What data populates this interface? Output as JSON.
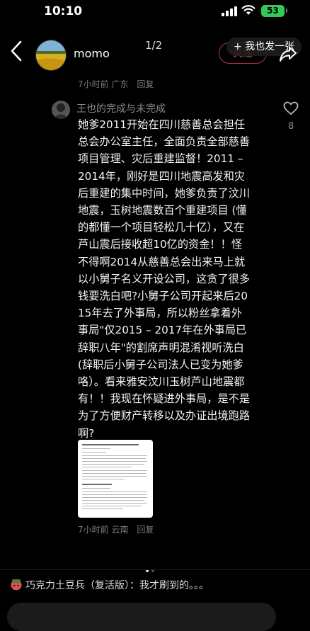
{
  "status_bar": {
    "time": "10:10",
    "battery": "53"
  },
  "header": {
    "username": "momo",
    "page_indicator": "1/2",
    "follow_label": "关注",
    "me_too_label": "+ 我也发一张"
  },
  "post_meta": {
    "time": "7小时前",
    "location": "广东",
    "reply_label": "回复"
  },
  "reply": {
    "author": "王也的完成与未完成",
    "likes": "8",
    "text": "她爹2011开始在四川慈善总会担任总会办公室主任，全面负责全部慈善项目管理、灾后重建监督！2011 – 2014年，刚好是四川地震高发和灾后重建的集中时间，她爹负责了汶川地震，玉树地震数百个重建项目 (懂的都懂一个项目轻松几十亿），又在芦山震后接收超10亿的资金！！怪不得啊2014从慈善总会出来马上就以小舅子名义开设公司，这贪了很多钱要洗白吧?小舅子公司开起来后2015年去了外事局，所以粉丝拿着外事局\"仅2015 – 2017年在外事局已辞职八年\"的割席声明混淆视听洗白 (辞职后小舅子公司法人已变为她爹咯）。看来雅安汶川玉树芦山地震都有！！我现在怀疑进外事局，是不是为了方便财产转移以及办证出境跑路啊?",
    "meta": {
      "time": "7小时前",
      "location": "云南",
      "reply_label": "回复"
    }
  },
  "bottom_comment": {
    "author": "巧克力土豆兵（复活版）",
    "separator": "：",
    "text": "我才刷到的。。。"
  },
  "icons": {
    "back": "back-chevron-icon",
    "share": "share-arrow-icon",
    "like": "heart-outline-icon",
    "signal": "signal-icon",
    "wifi": "wifi-icon"
  },
  "colors": {
    "accent": "#e84a60",
    "battery": "#34c759",
    "muted": "#7b7b7b"
  }
}
